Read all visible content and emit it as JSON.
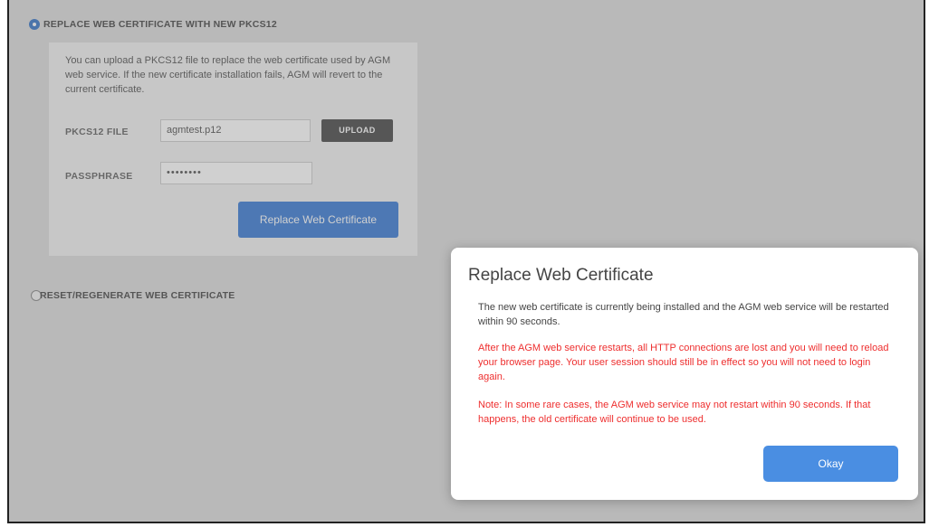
{
  "options": {
    "replace": {
      "label": "REPLACE WEB CERTIFICATE WITH NEW PKCS12",
      "description": "You can upload a PKCS12 file to replace the web certificate used by AGM web service. If the new certificate installation fails, AGM will revert to the current certificate.",
      "pkcs12_label": "PKCS12 FILE",
      "pkcs12_value": "agmtest.p12",
      "upload_label": "UPLOAD",
      "passphrase_label": "PASSPHRASE",
      "passphrase_value": "••••••••",
      "submit_label": "Replace Web Certificate"
    },
    "reset": {
      "label": "RESET/REGENERATE WEB CERTIFICATE"
    }
  },
  "dialog": {
    "title": "Replace Web Certificate",
    "message": "The new web certificate is currently being installed and the AGM web service will be restarted within 90 seconds.",
    "warning1": "After the AGM web service restarts, all HTTP connections are lost and you will need to reload your browser page. Your user session should still be in effect so you will not need to login again.",
    "warning2": "Note: In some rare cases, the AGM web service may not restart within 90 seconds. If that happens, the old certificate will continue to be used.",
    "okay_label": "Okay"
  },
  "colors": {
    "accent": "#3e7ed6",
    "warning_text": "#ee2e2e",
    "upload_button": "#4c4c4c"
  }
}
